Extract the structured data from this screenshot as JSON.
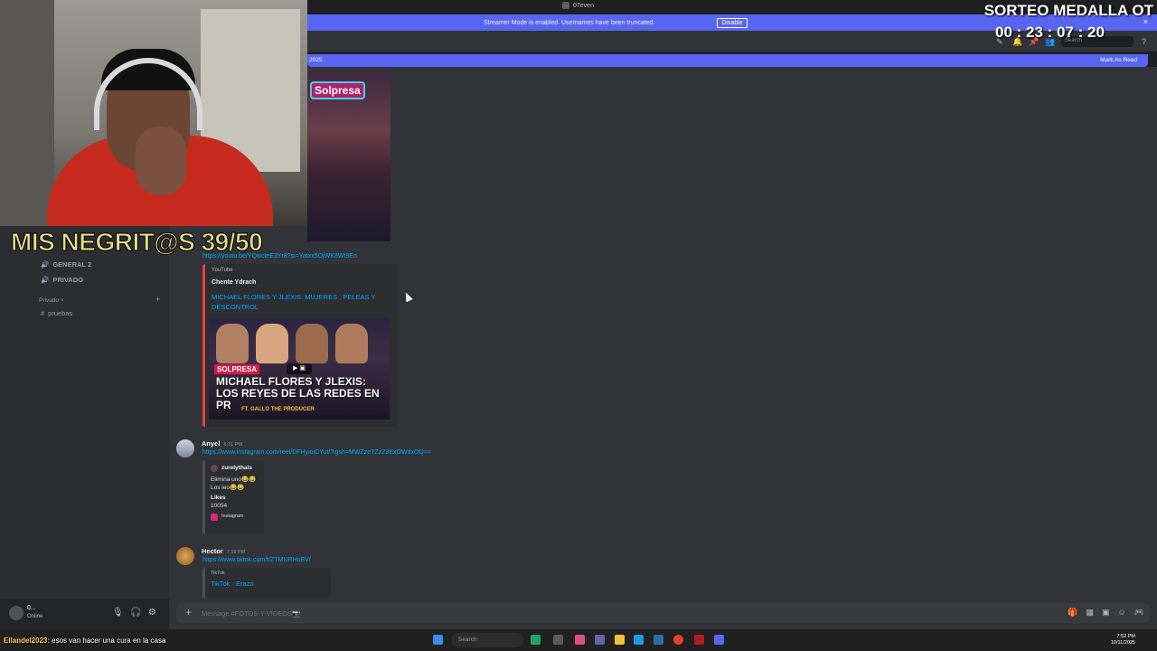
{
  "window": {
    "title": "07even"
  },
  "banner": {
    "message": "Streamer Mode is enabled. Usernames have been truncated.",
    "disable_label": "Disable",
    "close": "×"
  },
  "header": {
    "search_placeholder": "Search"
  },
  "new_messages_bar": {
    "since": "2025",
    "mark_read": "Mark As Read"
  },
  "sidebar": {
    "voice_channels": [
      {
        "label": "GENERAL 2"
      },
      {
        "label": "PRIVADO"
      }
    ],
    "category": {
      "label": "Privado",
      "add": "+"
    },
    "text_channels": [
      {
        "label": "pruebas"
      }
    ]
  },
  "user_panel": {
    "name": "0...",
    "status": "Online"
  },
  "messages": {
    "top_thumb_tag": "Solpresa",
    "youtube_link": "https://youtu.be/YQwcIeE3Yr8?si=Yatxx5OjWK8Wt9En",
    "youtube_embed": {
      "provider": "YouTube",
      "author": "Chente Ydrach",
      "title": "MICHAEL FLORES Y JLEXIS: MUJERES , PELEAS Y DESCONTROL",
      "thumb_badge": "SOLPRESA",
      "thumb_headline": "MICHAEL FLORES Y JLEXIS: LOS REYES DE LAS REDES EN PR",
      "thumb_sub": "FT. GALLO THE PRODUCER"
    },
    "anyel": {
      "name": "Anyel",
      "time": "6:31 PM",
      "link": "https://www.instagram.com/reel/DFHyioiCYut/?igsh=MWZzeTZzZ3ExOWdxOQ==",
      "ig_embed": {
        "author": "zurelythais",
        "line1": "Elimina uno😂😂",
        "line2": "Los leo😂😂",
        "likes_label": "Likes",
        "likes_value": "10054",
        "footer": "Instagram"
      }
    },
    "hector": {
      "name": "Hector",
      "time": "7:18 PM",
      "link": "https://www.tiktok.com/t/ZTMURHuBV/",
      "tt_embed": {
        "provider": "TikTok",
        "title": "TikTok · Erazo"
      }
    }
  },
  "composer": {
    "plus": "+",
    "placeholder": "Message #FOTOS-Y-VIDEOS📷"
  },
  "taskbar": {
    "search_placeholder": "Search",
    "time": "7:52 PM",
    "date": "10/11/2025"
  },
  "overlays": {
    "counter": "MIS NEGRIT@S 39/50",
    "giveaway": "SORTEO MEDALLA OT",
    "timer": "00 : 23 : 07 : 20",
    "chat_user": "Ellandel2023:",
    "chat_message": "esos van hacer una cura en la casa"
  },
  "colors": {
    "blurple": "#5865f2",
    "link": "#00a8fc",
    "bg": "#313338",
    "embed_red": "#e4443d"
  }
}
